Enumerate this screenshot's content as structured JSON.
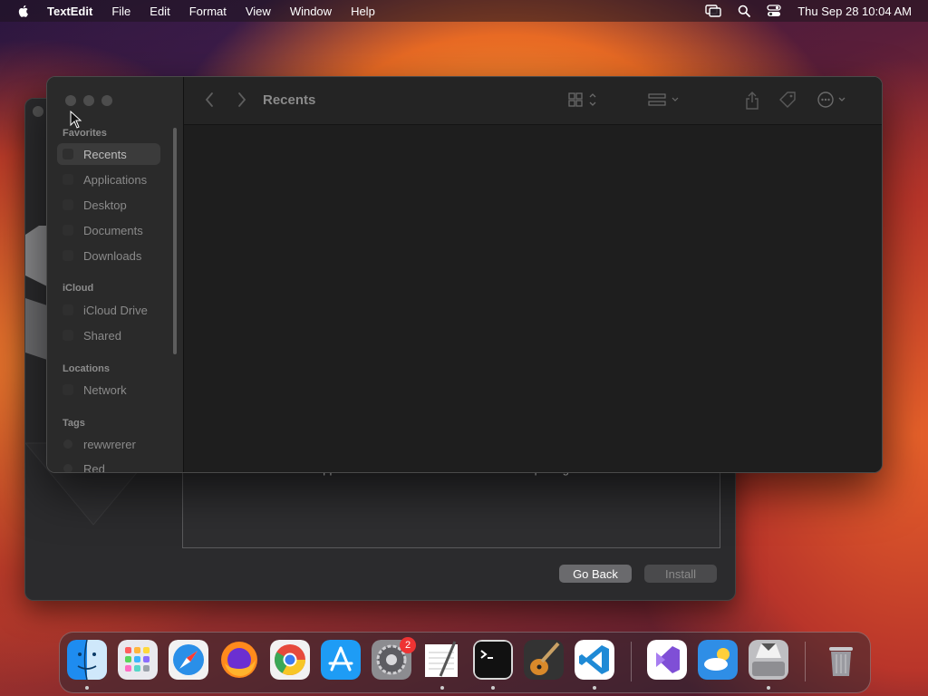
{
  "menubar": {
    "app_name": "TextEdit",
    "menus": [
      "File",
      "Edit",
      "Format",
      "View",
      "Window",
      "Help"
    ],
    "clock": "Thu Sep 28  10:04 AM"
  },
  "installer": {
    "notice": "Windows Support Software will be installed after completing Windows installation.",
    "go_back_label": "Go Back",
    "install_label": "Install"
  },
  "finder": {
    "title": "Recents",
    "sidebar": {
      "favorites_header": "Favorites",
      "favorites": [
        "Recents",
        "Applications",
        "Desktop",
        "Documents",
        "Downloads"
      ],
      "icloud_header": "iCloud",
      "icloud": [
        "iCloud Drive",
        "Shared"
      ],
      "locations_header": "Locations",
      "locations": [
        "Network"
      ],
      "tags_header": "Tags",
      "tags": [
        "rewwrerer",
        "Red"
      ]
    }
  },
  "dock": {
    "apps": [
      "finder-icon",
      "launchpad-icon",
      "safari-icon",
      "firefox-icon",
      "chrome-icon",
      "app-store-icon",
      "system-settings-icon",
      "textedit-icon",
      "terminal-icon",
      "garageband-icon",
      "vscode-icon",
      "visual-studio-icon",
      "weather-icon",
      "boot-camp-icon",
      "trash-icon"
    ],
    "settings_badge": "2"
  },
  "colors": {
    "finder_bg": "#1e1e1e",
    "sidebar_bg": "#2a2a2a",
    "warning": "#f5c400"
  }
}
